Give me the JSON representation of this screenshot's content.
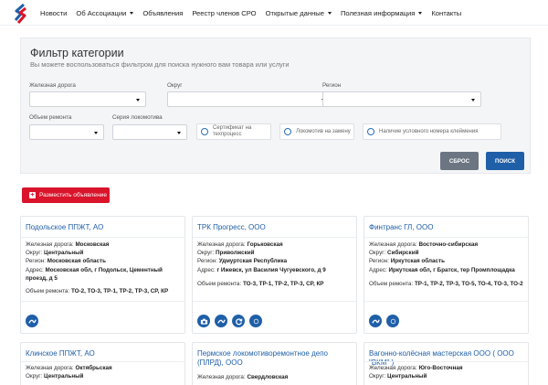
{
  "nav": {
    "items": [
      {
        "label": "Новости",
        "has_dropdown": false
      },
      {
        "label": "Об Ассоциации",
        "has_dropdown": true
      },
      {
        "label": "Объявления",
        "has_dropdown": false
      },
      {
        "label": "Реестр членов СРО",
        "has_dropdown": false
      },
      {
        "label": "Открытые данные",
        "has_dropdown": true
      },
      {
        "label": "Полезная информация",
        "has_dropdown": true
      },
      {
        "label": "Контакты",
        "has_dropdown": false
      }
    ]
  },
  "filter": {
    "title": "Фильтр категории",
    "subtitle": "Вы можете воспользоваться фильтром для поиска нужного вам товара или услуги",
    "labels": {
      "railway": "Железная дорога",
      "district": "Округ",
      "region": "Регион",
      "repair_volume": "Объем ремонта",
      "loco_series": "Серия локомотива"
    },
    "checks": {
      "certificate": "Сертификат на техпроцесс",
      "loco_replace": "Локомотив на замену",
      "stamp_number": "Наличие условного номера клеймения"
    },
    "reset_label": "СБРОС",
    "search_label": "ПОИСК"
  },
  "post_ad": {
    "label": "Разместить объявление"
  },
  "card_labels": {
    "railway": "Железная дорога:",
    "district": "Округ:",
    "region": "Регион:",
    "address": "Адрес:",
    "repair": "Объем ремонта:"
  },
  "cards": [
    {
      "title": "Подольское ППЖТ, АО",
      "railway": "Московская",
      "district": "Центральный",
      "region": "Московская область",
      "address": "Московская обл, г Подольск, Цементный проезд, д 5",
      "repair": "ТО-2, ТО-3, ТР-1, ТР-2, ТР-3, СР, КР",
      "icons": [
        "wrench-icon"
      ]
    },
    {
      "title": "ТРК Прогресс, ООО",
      "railway": "Горьковская",
      "district": "Приволжский",
      "region": "Удмуртская Республика",
      "address": "г Ижевск, ул Василия Чугуевского, д 9",
      "repair": "ТО-3, ТР-1, ТР-2, ТР-3, СР, КР",
      "icons": [
        "camera-icon",
        "wrench-icon",
        "refresh-icon",
        "dot-icon"
      ]
    },
    {
      "title": "Финтранс ГЛ, ООО",
      "railway": "Восточно-сибирская",
      "district": "Сибирский",
      "region": "Иркутская область",
      "address": "Иркутская обл, г Братск, тер Промплощадка",
      "repair": "ТР-1, ТР-2, ТР-3, ТО-5, ТО-4, ТО-3, ТО-2",
      "icons": [
        "wrench-icon",
        "dot-icon"
      ]
    },
    {
      "title": "Клинское ППЖТ, АО",
      "railway": "Октябрьская",
      "district": "Центральный"
    },
    {
      "title": "Пермское локомотиворемонтное депо (ПЛРД), ООО",
      "railway": "Свердловская"
    },
    {
      "title": "Вагонно-колёсная мастерская ООО ( ООО \"ВКМ\" )",
      "railway": "Юго-Восточная",
      "district": "Центральный"
    }
  ],
  "colors": {
    "accent_blue": "#1f5fa8",
    "accent_red": "#d9142b",
    "reset_gray": "#6b7682",
    "panel_bg": "#f4f5f7"
  }
}
